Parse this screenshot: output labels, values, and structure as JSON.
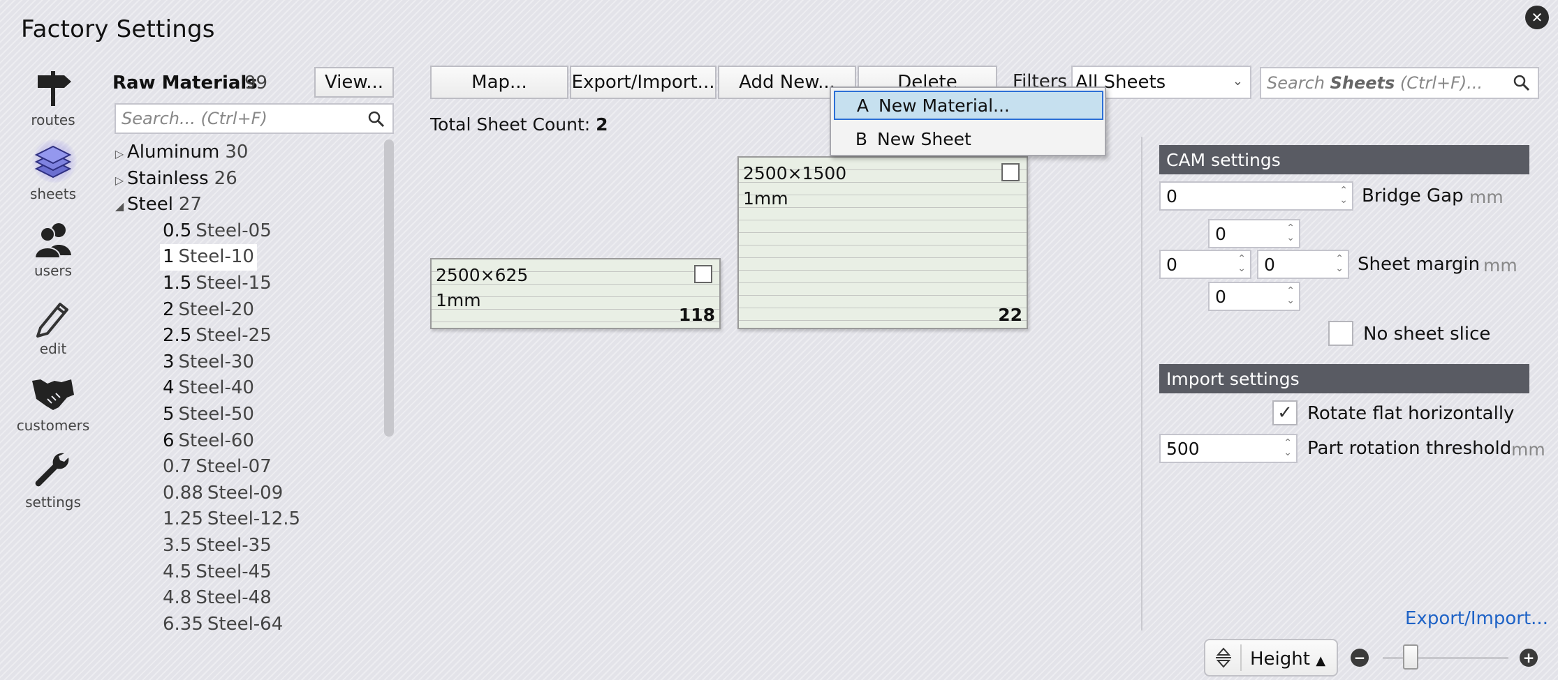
{
  "window": {
    "title": "Factory Settings",
    "close_icon": "close-icon"
  },
  "nav": [
    {
      "label": "routes",
      "icon": "signpost-icon"
    },
    {
      "label": "sheets",
      "icon": "sheets-stack-icon",
      "active": true
    },
    {
      "label": "users",
      "icon": "users-icon"
    },
    {
      "label": "edit",
      "icon": "pencil-icon"
    },
    {
      "label": "customers",
      "icon": "handshake-icon"
    },
    {
      "label": "settings",
      "icon": "wrench-icon"
    }
  ],
  "materials": {
    "title": "Raw Materials",
    "count": "99",
    "view_button": "View...",
    "search_placeholder": "Search... (Ctrl+F)",
    "groups": [
      {
        "name": "Aluminum",
        "count": "30",
        "expanded": false
      },
      {
        "name": "Stainless",
        "count": "26",
        "expanded": false
      },
      {
        "name": "Steel",
        "count": "27",
        "expanded": true
      }
    ],
    "children": [
      {
        "thickness": "0.5",
        "name": "Steel-05",
        "bold": true
      },
      {
        "thickness": "1",
        "name": "Steel-10",
        "bold": true,
        "selected": true
      },
      {
        "thickness": "1.5",
        "name": "Steel-15",
        "bold": true
      },
      {
        "thickness": "2",
        "name": "Steel-20",
        "bold": true
      },
      {
        "thickness": "2.5",
        "name": "Steel-25",
        "bold": true
      },
      {
        "thickness": "3",
        "name": "Steel-30",
        "bold": true
      },
      {
        "thickness": "4",
        "name": "Steel-40",
        "bold": true
      },
      {
        "thickness": "5",
        "name": "Steel-50",
        "bold": true
      },
      {
        "thickness": "6",
        "name": "Steel-60",
        "bold": true
      },
      {
        "thickness": "0.7",
        "name": "Steel-07",
        "bold": false
      },
      {
        "thickness": "0.88",
        "name": "Steel-09",
        "bold": false
      },
      {
        "thickness": "1.25",
        "name": "Steel-12.5",
        "bold": false
      },
      {
        "thickness": "3.5",
        "name": "Steel-35",
        "bold": false
      },
      {
        "thickness": "4.5",
        "name": "Steel-45",
        "bold": false
      },
      {
        "thickness": "4.8",
        "name": "Steel-48",
        "bold": false
      },
      {
        "thickness": "6.35",
        "name": "Steel-64",
        "bold": false
      }
    ]
  },
  "toolbar": {
    "map": "Map...",
    "export_import": "Export/Import...",
    "add_new": "Add New...",
    "delete": "Delete",
    "filters_label": "Filters",
    "filter_value": "All Sheets",
    "search_prefix": "Search ",
    "search_bold": "Sheets",
    "search_suffix": " (Ctrl+F)..."
  },
  "total": {
    "label": "Total Sheet Count: ",
    "value": "2"
  },
  "dropdown": [
    {
      "key": "A",
      "label": "New Material...",
      "highlighted": true
    },
    {
      "key": "B",
      "label": "New Sheet",
      "highlighted": false
    }
  ],
  "sheets": [
    {
      "size": "2500×625",
      "thickness": "1mm",
      "quantity": "118"
    },
    {
      "size": "2500×1500",
      "thickness": "1mm",
      "quantity": "22"
    }
  ],
  "cam": {
    "heading": "CAM settings",
    "bridge_gap_value": "0",
    "bridge_gap_label": "Bridge Gap",
    "bridge_gap_unit": "mm",
    "margin_top": "0",
    "margin_left": "0",
    "margin_right": "0",
    "margin_bottom": "0",
    "margin_label": "Sheet margin",
    "margin_unit": "mm",
    "no_slice_label": "No sheet slice"
  },
  "import": {
    "heading": "Import settings",
    "rotate_label": "Rotate flat horizontally",
    "threshold_value": "500",
    "threshold_label": "Part rotation threshold",
    "threshold_unit": "mm"
  },
  "footer": {
    "export_link": "Export/Import...",
    "zoom_mode": "Height",
    "zoom_level": 0.22
  }
}
